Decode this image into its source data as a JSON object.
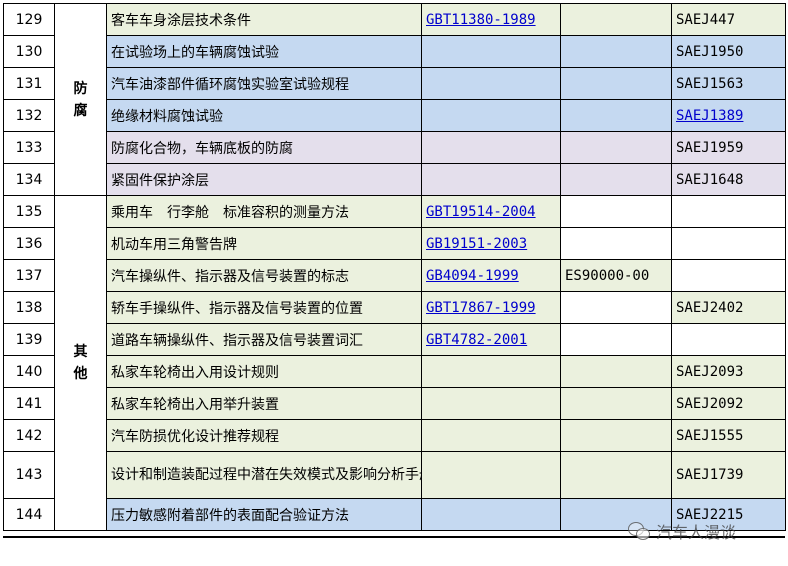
{
  "categories": {
    "anticorrosion": "防腐",
    "other": "其他"
  },
  "rows": [
    {
      "no": "129",
      "title": "客车车身涂层技术条件",
      "gb": "GBT11380-1989",
      "other": "",
      "sae": "SAEJ447"
    },
    {
      "no": "130",
      "title": "在试验场上的车辆腐蚀试验",
      "gb": "",
      "other": "",
      "sae": "SAEJ1950"
    },
    {
      "no": "131",
      "title": "汽车油漆部件循环腐蚀实验室试验规程",
      "gb": "",
      "other": "",
      "sae": "SAEJ1563"
    },
    {
      "no": "132",
      "title": "绝缘材料腐蚀试验",
      "gb": "",
      "other": "",
      "sae": "SAEJ1389"
    },
    {
      "no": "133",
      "title": "防腐化合物，车辆底板的防腐",
      "gb": "",
      "other": "",
      "sae": "SAEJ1959"
    },
    {
      "no": "134",
      "title": "紧固件保护涂层",
      "gb": "",
      "other": "",
      "sae": "SAEJ1648"
    },
    {
      "no": "135",
      "title": "乘用车　行李舱　标准容积的测量方法",
      "gb": "GBT19514-2004",
      "other": "",
      "sae": ""
    },
    {
      "no": "136",
      "title": "机动车用三角警告牌",
      "gb": "GB19151-2003",
      "other": "",
      "sae": ""
    },
    {
      "no": "137",
      "title": "汽车操纵件、指示器及信号装置的标志",
      "gb": "GB4094-1999",
      "other": "ES90000-00",
      "sae": ""
    },
    {
      "no": "138",
      "title": "轿车手操纵件、指示器及信号装置的位置",
      "gb": "GBT17867-1999",
      "other": "",
      "sae": "SAEJ2402"
    },
    {
      "no": "139",
      "title": "道路车辆操纵件、指示器及信号装置词汇",
      "gb": "GBT4782-2001",
      "other": "",
      "sae": ""
    },
    {
      "no": "140",
      "title": "私家车轮椅出入用设计规则",
      "gb": "",
      "other": "",
      "sae": "SAEJ2093"
    },
    {
      "no": "141",
      "title": "私家车轮椅出入用举升装置",
      "gb": "",
      "other": "",
      "sae": "SAEJ2092"
    },
    {
      "no": "142",
      "title": "汽车防损优化设计推荐规程",
      "gb": "",
      "other": "",
      "sae": "SAEJ1555"
    },
    {
      "no": "143",
      "title": "设计和制造装配过程中潜在失效模式及影响分析手册",
      "gb": "",
      "other": "",
      "sae": "SAEJ1739"
    },
    {
      "no": "144",
      "title": "压力敏感附着部件的表面配合验证方法",
      "gb": "",
      "other": "",
      "sae": "SAEJ2215"
    }
  ],
  "watermark": "汽车人漫谈",
  "colors": {
    "green": "#ebf1de",
    "blue": "#c5d9f1",
    "purple": "#e4dfec",
    "link": "#0000cc"
  }
}
